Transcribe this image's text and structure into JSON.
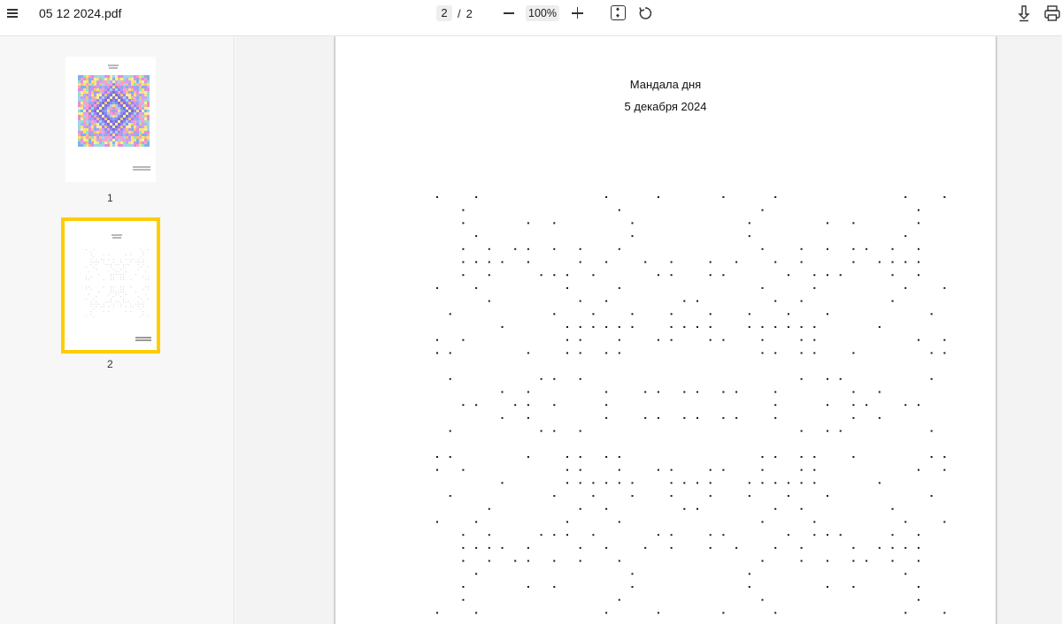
{
  "toolbar": {
    "menu_icon": "hamburger-menu-icon",
    "document_title": "05 12 2024.pdf",
    "current_page": "2",
    "page_separator": "/",
    "total_pages": "2",
    "zoom_level": "100%",
    "icons": [
      "zoom-out-icon",
      "zoom-in-icon",
      "fit-page-icon",
      "rotate-icon",
      "download-icon",
      "print-icon"
    ]
  },
  "sidebar": {
    "thumbnails": [
      {
        "label": "1",
        "selected": false
      },
      {
        "label": "2",
        "selected": true
      }
    ],
    "selection_color": "#ffcc00"
  },
  "page": {
    "title": "Мандала дня",
    "date": "5 декабря 2024"
  }
}
